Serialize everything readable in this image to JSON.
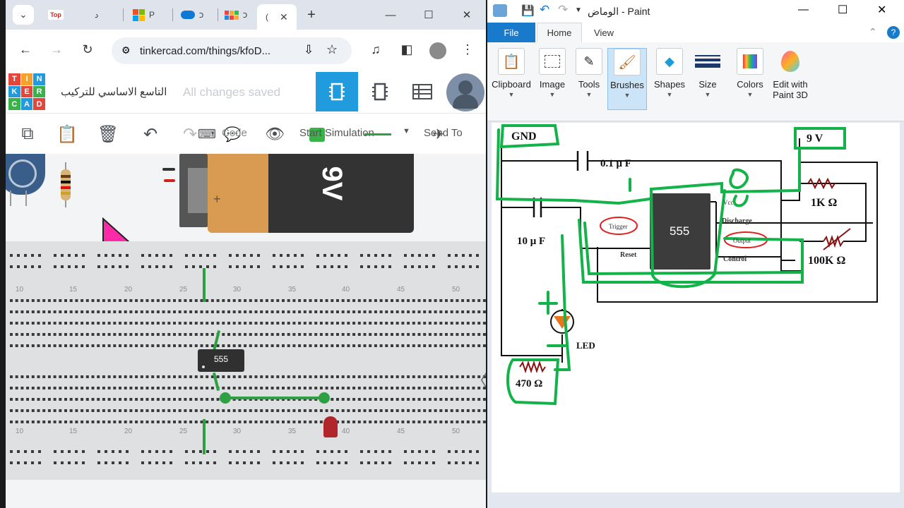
{
  "browser": {
    "tabs": [
      {
        "label": "د",
        "favicon_text": "Top"
      },
      {
        "label": "P"
      },
      {
        "label": "כ"
      },
      {
        "label": "כ"
      },
      {
        "label": "("
      }
    ],
    "new_tab": "+",
    "url": "tinkercad.com/things/kfoD..."
  },
  "tinkercad": {
    "logo": [
      "TIN",
      "KER",
      "CAD"
    ],
    "design_title": "التاسع الاساسي للتركيب",
    "save_status": "All changes saved",
    "toolbar": {
      "code": "Code",
      "start_simulation": "Start Simulation",
      "send_to": "Send To"
    },
    "battery_label": "9V",
    "chip_label": "555",
    "row_numbers": [
      "10",
      "15",
      "20",
      "25",
      "30",
      "35",
      "40",
      "45",
      "50"
    ]
  },
  "paint": {
    "title": "الوماض - Paint",
    "menu": {
      "file": "File",
      "home": "Home",
      "view": "View"
    },
    "ribbon": [
      "Clipboard",
      "Image",
      "Tools",
      "Brushes",
      "Shapes",
      "Size",
      "Colors",
      "Edit with Paint 3D"
    ],
    "circuit": {
      "gnd": "GND",
      "vcc": "9 V",
      "cap1": "0.1 μ F",
      "cap2": "10 μ F",
      "r1": "1K Ω",
      "r2": "100K Ω",
      "r3": "470 Ω",
      "led": "LED",
      "ic": "555",
      "pins": [
        "Discharge",
        "Reset",
        "Control",
        "Vcc",
        "Trigger",
        "Output"
      ]
    }
  },
  "colors": {
    "tinkercad_blue": "#1f9bde",
    "paint_blue": "#1979ca",
    "wire_green": "#2ea043",
    "annot_green": "#14b34a",
    "annot_red": "#e02020"
  }
}
